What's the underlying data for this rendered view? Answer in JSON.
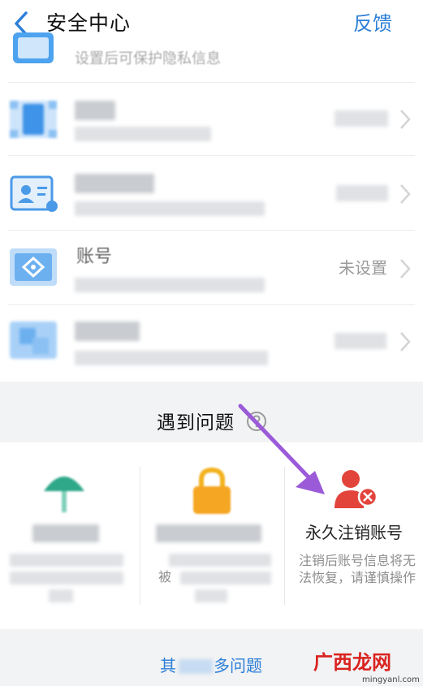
{
  "header": {
    "title": "安全中心",
    "feedback": "反馈"
  },
  "settings": {
    "top_partial_text": "设置后可保护隐私信息",
    "rows": [
      {
        "title": "",
        "subtitle": "",
        "status": ""
      },
      {
        "title": "",
        "subtitle": "",
        "status": ""
      },
      {
        "title": "账号",
        "subtitle": "",
        "status": "未设置"
      },
      {
        "title": "",
        "subtitle": "",
        "status": ""
      }
    ]
  },
  "problems": {
    "title": "遇到问题",
    "cards": [
      {
        "title": "",
        "desc": ""
      },
      {
        "title": "",
        "desc": "被"
      },
      {
        "title": "永久注销账号",
        "desc": "注销后账号信息将无法恢复，请谨慎操作"
      }
    ],
    "more_link_start": "其",
    "more_link_end": "多问题"
  },
  "watermark": {
    "text": "广西龙网",
    "url_text": "mingyanl.com"
  },
  "colors": {
    "accent": "#2c7fd8",
    "annotation_arrow": "#9b5bd8",
    "delete_icon": "#e2443c"
  }
}
